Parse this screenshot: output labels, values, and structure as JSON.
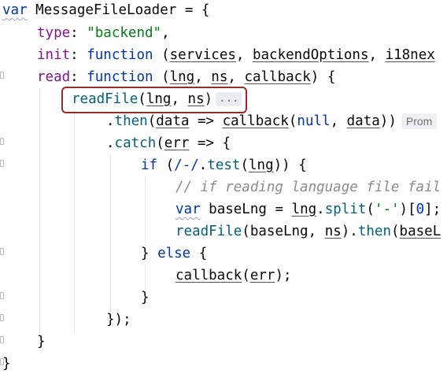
{
  "code": {
    "l1": {
      "kw": "var",
      "name": "MessageFileLoader",
      "rest": " = {"
    },
    "l2": {
      "prop": "type",
      "colon": ": ",
      "str": "\"backend\"",
      "comma": ","
    },
    "l3": {
      "prop": "init",
      "colon": ": ",
      "kw": "function",
      "open": " (",
      "p1": "services",
      "sep1": ", ",
      "p2": "backendOptions",
      "sep2": ", ",
      "p3": "i18nex"
    },
    "l4": {
      "prop": "read",
      "colon": ": ",
      "kw": "function",
      "open": " (",
      "p1": "lng",
      "sep1": ", ",
      "p2": "ns",
      "sep2": ", ",
      "p3": "callback",
      "close": ") {"
    },
    "l5": {
      "fn": "readFile",
      "open": "(",
      "p1": "lng",
      "sep": ", ",
      "p2": "ns",
      "close": ")",
      "fold": "..."
    },
    "l6": {
      "dot": ".",
      "fn": "then",
      "open": "(",
      "p1": "data",
      "arrow": " => ",
      "fn2": "callback",
      "open2": "(",
      "kw": "null",
      "sep": ", ",
      "p2": "data",
      "close": "))",
      "hint": "Prom"
    },
    "l7": {
      "dot": ".",
      "fn": "catch",
      "open": "(",
      "p1": "err",
      "rest": " => {"
    },
    "l8": {
      "kw": "if",
      "open": " (",
      "regex": "/-/",
      "dot": ".",
      "fn": "test",
      "open2": "(",
      "p1": "lng",
      "close": ")) {"
    },
    "l9": {
      "comment": "// if reading language file fail"
    },
    "l10": {
      "kw": "var",
      "name": "baseLng",
      "eq": " = ",
      "p1": "lng",
      "dot": ".",
      "fn": "split",
      "open": "(",
      "str": "'-'",
      "close": ")[",
      "num": "0",
      "end": "];"
    },
    "l11": {
      "fn": "readFile",
      "open": "(",
      "p1": "baseLng",
      "sep": ", ",
      "p2": "ns",
      "close": ").",
      "fn2": "then",
      "open2": "(",
      "p3": "baseL"
    },
    "l12": {
      "text": "} ",
      "kw": "else",
      "rest": " {"
    },
    "l13": {
      "fn": "callback",
      "open": "(",
      "p1": "err",
      "close": ");"
    },
    "l14": {
      "text": "}"
    },
    "l15": {
      "text": "});"
    },
    "l16": {
      "text": "}"
    },
    "l17": {
      "text": "}"
    }
  }
}
